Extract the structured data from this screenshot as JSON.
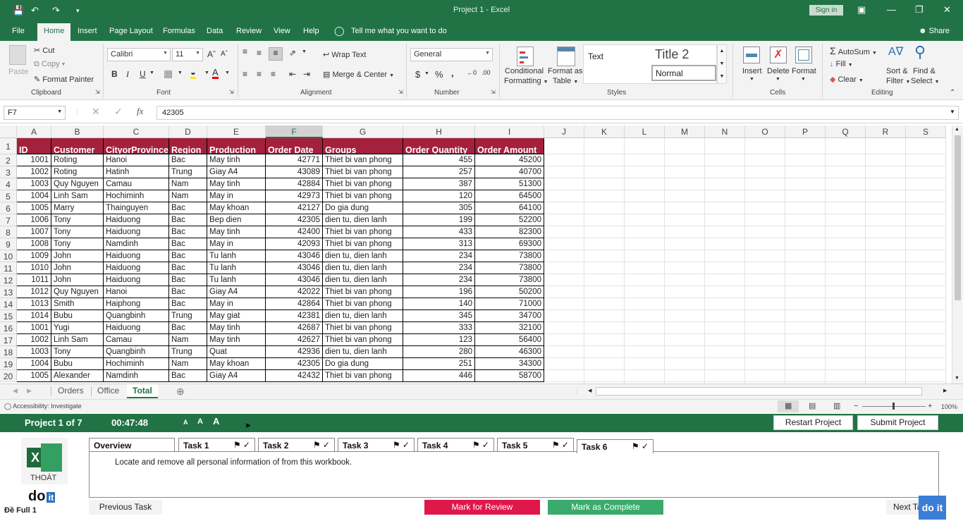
{
  "window": {
    "title": "Project 1  -  Excel",
    "sign_in": "Sign in",
    "share": "Share",
    "tell_me": "Tell me what you want to do"
  },
  "tabs": [
    "File",
    "Home",
    "Insert",
    "Page Layout",
    "Formulas",
    "Data",
    "Review",
    "View",
    "Help"
  ],
  "ribbon": {
    "clipboard": {
      "paste": "Paste",
      "cut": "Cut",
      "copy": "Copy",
      "format_painter": "Format Painter",
      "label": "Clipboard"
    },
    "font": {
      "name": "Calibri",
      "size": "11",
      "label": "Font"
    },
    "alignment": {
      "wrap": "Wrap Text",
      "merge": "Merge & Center",
      "label": "Alignment"
    },
    "number": {
      "format": "General",
      "label": "Number"
    },
    "styles": {
      "cond1": "Conditional",
      "cond2": "Formatting",
      "fmt1": "Format as",
      "fmt2": "Table",
      "text": "Text",
      "title2": "Title 2",
      "normal": "Normal",
      "label": "Styles"
    },
    "cells": {
      "insert": "Insert",
      "delete": "Delete",
      "format": "Format",
      "label": "Cells"
    },
    "editing": {
      "autosum": "AutoSum",
      "fill": "Fill",
      "clear": "Clear",
      "sort1": "Sort &",
      "sort2": "Filter",
      "find1": "Find &",
      "find2": "Select",
      "label": "Editing"
    }
  },
  "formula_bar": {
    "name_box": "F7",
    "value": "42305"
  },
  "grid": {
    "columns": [
      "A",
      "B",
      "C",
      "D",
      "E",
      "F",
      "G",
      "H",
      "I",
      "J",
      "K",
      "L",
      "M",
      "N",
      "O",
      "P",
      "Q",
      "R",
      "S"
    ],
    "headers": [
      "ID",
      "Customer",
      "CityorProvince",
      "Region",
      "Production",
      "Order Date",
      "Groups",
      "Order Quantity",
      "Order Amount"
    ],
    "row_numbers": [
      "1",
      "2",
      "3",
      "4",
      "5",
      "6",
      "7",
      "8",
      "9",
      "10",
      "11",
      "12",
      "13",
      "14",
      "15",
      "16",
      "17",
      "18",
      "19",
      "20"
    ],
    "rows": [
      [
        "1001",
        "Roting",
        "Hanoi",
        "Bac",
        "May tinh",
        "42771",
        "Thiet bi van phong",
        "455",
        "45200"
      ],
      [
        "1002",
        "Roting",
        "Hatinh",
        "Trung",
        "Giay A4",
        "43089",
        "Thiet bi van phong",
        "257",
        "40700"
      ],
      [
        "1003",
        "Quy Nguyen",
        "Camau",
        "Nam",
        "May tinh",
        "42884",
        "Thiet bi van phong",
        "387",
        "51300"
      ],
      [
        "1004",
        "Linh Sam",
        "Hochiminh",
        "Nam",
        "May in",
        "42973",
        "Thiet bi van phong",
        "120",
        "64500"
      ],
      [
        "1005",
        "Marry",
        "Thainguyen",
        "Bac",
        "May khoan",
        "42127",
        "Do gia dung",
        "305",
        "64100"
      ],
      [
        "1006",
        "Tony",
        "Haiduong",
        "Bac",
        "Bep dien",
        "42305",
        "dien tu, dien lanh",
        "199",
        "52200"
      ],
      [
        "1007",
        "Tony",
        "Haiduong",
        "Bac",
        "May tinh",
        "42400",
        "Thiet bi van phong",
        "433",
        "82300"
      ],
      [
        "1008",
        "Tony",
        "Namdinh",
        "Bac",
        "May in",
        "42093",
        "Thiet bi van phong",
        "313",
        "69300"
      ],
      [
        "1009",
        "John",
        "Haiduong",
        "Bac",
        "Tu lanh",
        "43046",
        "dien tu, dien lanh",
        "234",
        "73800"
      ],
      [
        "1010",
        "John",
        "Haiduong",
        "Bac",
        "Tu lanh",
        "43046",
        "dien tu, dien lanh",
        "234",
        "73800"
      ],
      [
        "1011",
        "John",
        "Haiduong",
        "Bac",
        "Tu lanh",
        "43046",
        "dien tu, dien lanh",
        "234",
        "73800"
      ],
      [
        "1012",
        "Quy Nguyen",
        "Hanoi",
        "Bac",
        "Giay A4",
        "42022",
        "Thiet bi van phong",
        "196",
        "50200"
      ],
      [
        "1013",
        "Smith",
        "Haiphong",
        "Bac",
        "May in",
        "42864",
        "Thiet bi van phong",
        "140",
        "71000"
      ],
      [
        "1014",
        "Bubu",
        "Quangbinh",
        "Trung",
        "May giat",
        "42381",
        "dien tu, dien lanh",
        "345",
        "34700"
      ],
      [
        "1001",
        "Yugi",
        "Haiduong",
        "Bac",
        "May tinh",
        "42687",
        "Thiet bi van phong",
        "333",
        "32100"
      ],
      [
        "1002",
        "Linh Sam",
        "Camau",
        "Nam",
        "May tinh",
        "42627",
        "Thiet bi van phong",
        "123",
        "56400"
      ],
      [
        "1003",
        "Tony",
        "Quangbinh",
        "Trung",
        "Quat",
        "42936",
        "dien tu, dien lanh",
        "280",
        "46300"
      ],
      [
        "1004",
        "Bubu",
        "Hochiminh",
        "Nam",
        "May khoan",
        "42305",
        "Do gia dung",
        "251",
        "34300"
      ],
      [
        "1005",
        "Alexander",
        "Namdinh",
        "Bac",
        "Giay A4",
        "42432",
        "Thiet bi van phong",
        "446",
        "58700"
      ]
    ]
  },
  "sheets": [
    "Orders",
    "Office",
    "Total"
  ],
  "status": {
    "accessibility": "Accessibility: Investigate",
    "zoom": "100%"
  },
  "exam": {
    "project": "Project 1 of 7",
    "timer": "00:47:48",
    "font_sizes": [
      "A",
      "A",
      "A"
    ],
    "restart": "Restart Project",
    "submit": "Submit Project",
    "tabs": [
      "Overview",
      "Task 1",
      "Task 2",
      "Task 3",
      "Task 4",
      "Task 5",
      "Task 6"
    ],
    "task_text": "Locate and remove all personal information of from this workbook.",
    "logo_caption": "THOÁT",
    "exam_name": "Đề Full 1",
    "previous": "Previous Task",
    "review": "Mark for Review",
    "complete": "Mark as Complete",
    "next": "Next Task",
    "brand": "do it"
  },
  "colors": {
    "accent": "#217346",
    "header_fill": "#a4213d",
    "review": "#e0174a",
    "complete": "#3aab6d"
  }
}
